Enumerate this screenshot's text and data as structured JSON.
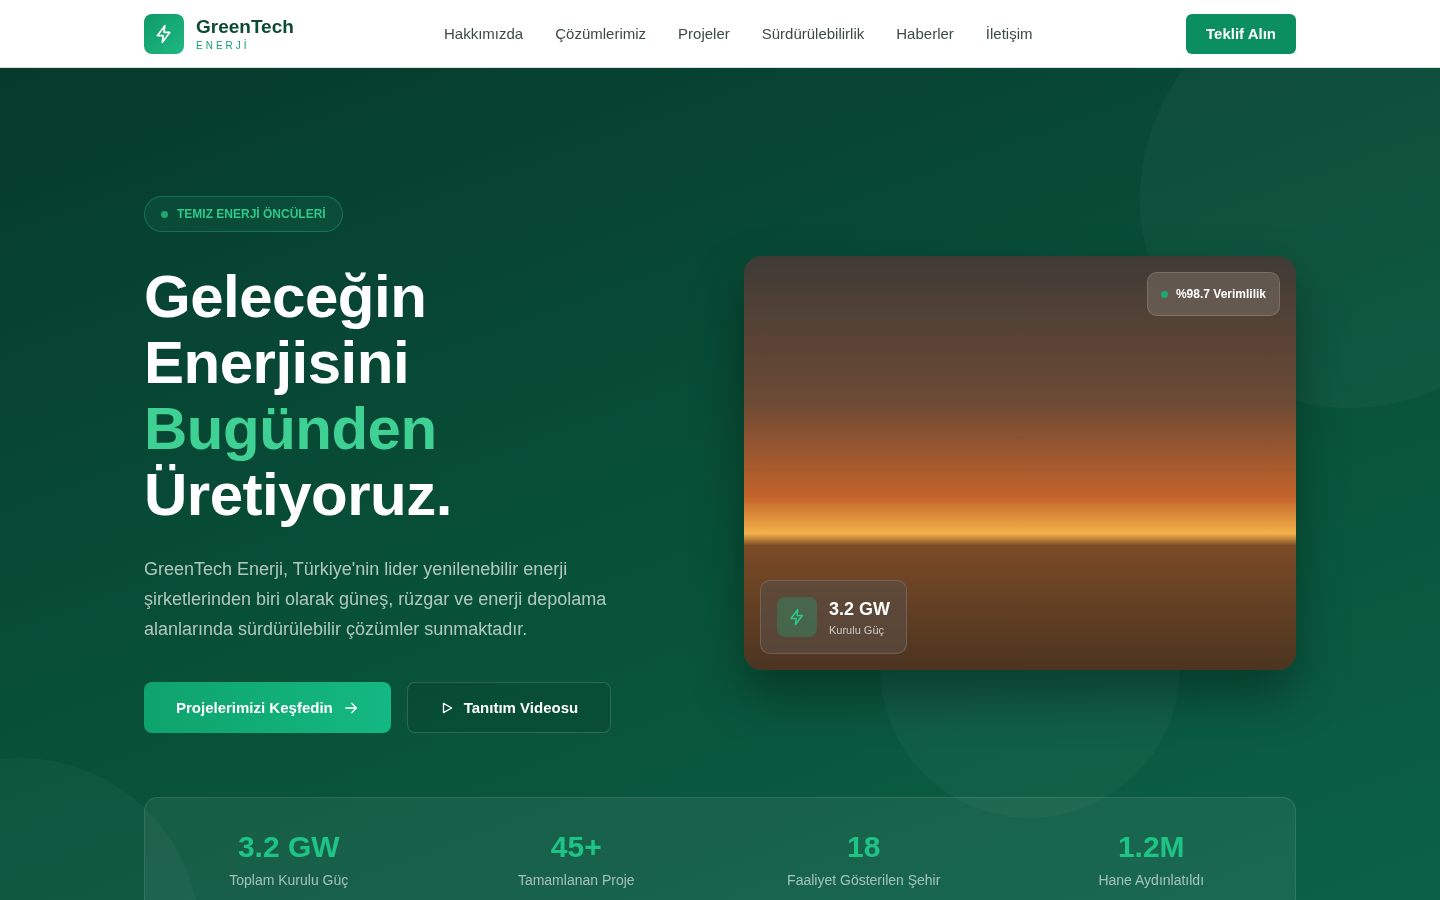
{
  "navbar": {
    "brand": {
      "name": "GreenTech",
      "tagline": "ENERJİ"
    },
    "links": [
      {
        "label": "Hakkımızda"
      },
      {
        "label": "Çözümlerimiz"
      },
      {
        "label": "Projeler"
      },
      {
        "label": "Sürdürülebilirlik"
      },
      {
        "label": "Haberler"
      },
      {
        "label": "İletişim"
      }
    ],
    "cta": "Teklif Alın"
  },
  "hero": {
    "badge": "TEMIZ ENERJİ ÖNCÜLERİ",
    "heading": [
      {
        "text": "Geleceğin",
        "kind": "plain"
      },
      {
        "text": "Enerjisini",
        "kind": "plain"
      },
      {
        "text": "Bugünden",
        "kind": "accent"
      },
      {
        "text": "Üretiyoruz.",
        "kind": "plain"
      }
    ],
    "description": "GreenTech Enerji, Türkiye'nin lider yenilenebilir enerji şirketlerinden biri olarak güneş, rüzgar ve enerji depolama alanlarında sürdürülebilir çözümler sunmaktadır.",
    "primary_button": "Projelerimizi Keşfedin",
    "secondary_button": "Tanıtım Videosu",
    "image_card": {
      "efficiency_badge": "%98.7 Verimlilik",
      "stat_value": "3.2 GW",
      "stat_label": "Kurulu Güç"
    }
  },
  "stats": [
    {
      "value": "3.2 GW",
      "label": "Toplam Kurulu Güç"
    },
    {
      "value": "45+",
      "label": "Tamamlanan Proje"
    },
    {
      "value": "18",
      "label": "Faaliyet Gösterilen Şehir"
    },
    {
      "value": "1.2M",
      "label": "Hane Aydınlatıldı"
    }
  ]
}
